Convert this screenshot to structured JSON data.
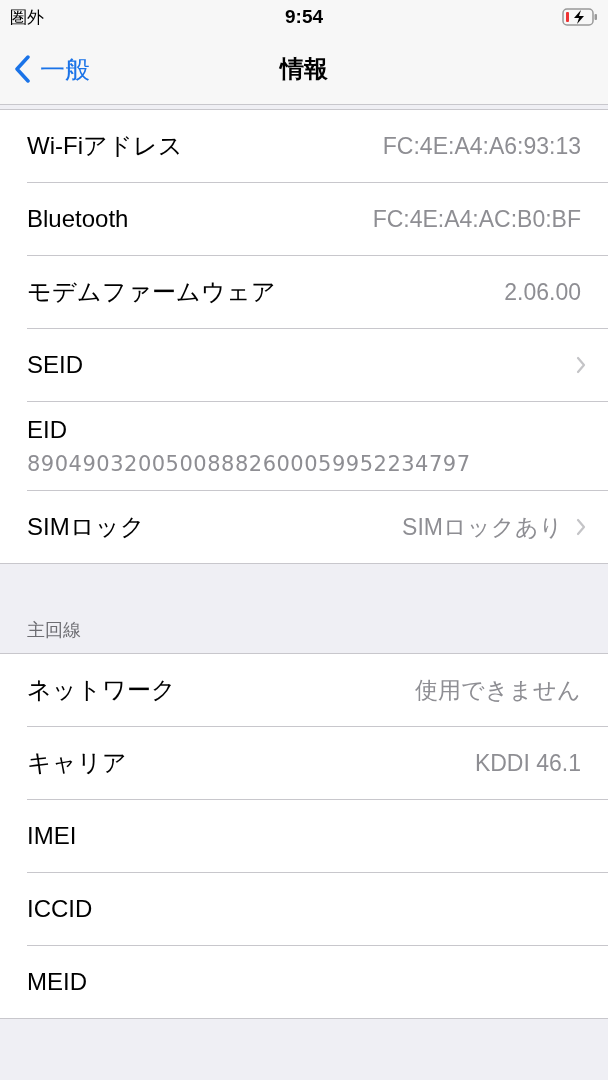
{
  "status_bar": {
    "carrier": "圏外",
    "time": "9:54",
    "battery_charging": true
  },
  "nav": {
    "back": "一般",
    "title": "情報"
  },
  "sections": [
    {
      "rows": [
        {
          "kind": "inline",
          "label": "Wi-Fiアドレス",
          "value": "FC:4E:A4:A6:93:13",
          "disclosure": false
        },
        {
          "kind": "inline",
          "label": "Bluetooth",
          "value": "FC:4E:A4:AC:B0:BF",
          "disclosure": false
        },
        {
          "kind": "inline",
          "label": "モデムファームウェア",
          "value": "2.06.00",
          "disclosure": false
        },
        {
          "kind": "inline",
          "label": "SEID",
          "disclosure": true
        },
        {
          "kind": "stacked",
          "label": "EID",
          "value": "89049032005008882600059952234797"
        },
        {
          "kind": "inline",
          "label": "SIMロック",
          "value": "SIMロックあり",
          "disclosure": true
        }
      ]
    },
    {
      "header": "主回線",
      "rows": [
        {
          "kind": "inline",
          "label": "ネットワーク",
          "value": "使用できません",
          "disclosure": false
        },
        {
          "kind": "inline",
          "label": "キャリア",
          "value": "KDDI 46.1",
          "disclosure": false
        },
        {
          "kind": "inline",
          "label": "IMEI",
          "disclosure": false
        },
        {
          "kind": "inline",
          "label": "ICCID",
          "disclosure": false
        },
        {
          "kind": "inline",
          "label": "MEID",
          "disclosure": false
        }
      ]
    }
  ]
}
